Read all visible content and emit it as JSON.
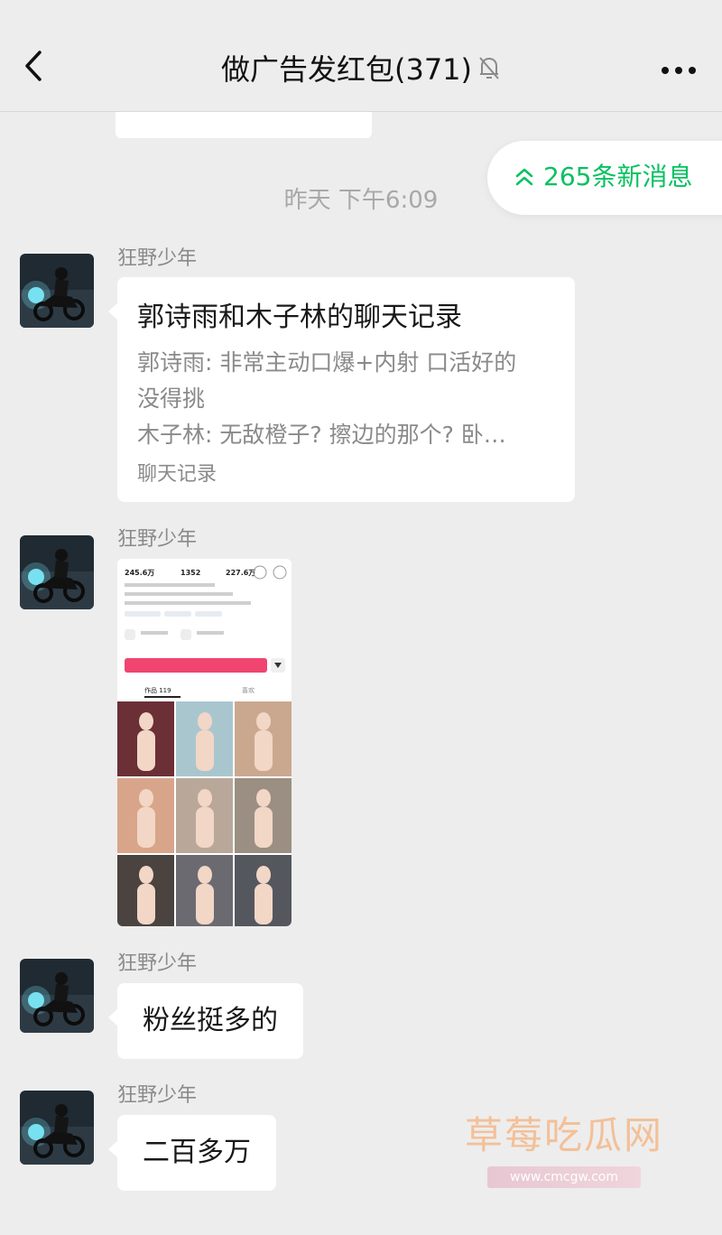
{
  "header": {
    "title": "做广告发红包(371)",
    "back_icon": "chevron-left-icon",
    "mute_icon": "bell-off-icon",
    "more_icon": "ellipsis-icon"
  },
  "new_messages": {
    "label": "265条新消息",
    "icon": "double-chevron-up-icon",
    "color": "#07c160"
  },
  "timestamp": "昨天 下午6:09",
  "messages": [
    {
      "sender": "狂野少年",
      "type": "chat-record",
      "title": "郭诗雨和木子林的聊天记录",
      "lines": [
        "郭诗雨: 非常主动口爆+内射 口活好的",
        "没得挑",
        "木子林: 无敌橙子? 擦边的那个? 卧…"
      ],
      "footer": "聊天记录"
    },
    {
      "sender": "狂野少年",
      "type": "image",
      "image": {
        "stats": [
          "245.6万",
          "1352",
          "227.6万"
        ],
        "tabs": [
          "作品 119",
          "喜欢"
        ]
      }
    },
    {
      "sender": "狂野少年",
      "type": "text",
      "text": "粉丝挺多的"
    },
    {
      "sender": "狂野少年",
      "type": "text",
      "text": "二百多万"
    }
  ],
  "watermark": {
    "title": "草莓吃瓜网",
    "url": "www.cmcgw.com"
  }
}
